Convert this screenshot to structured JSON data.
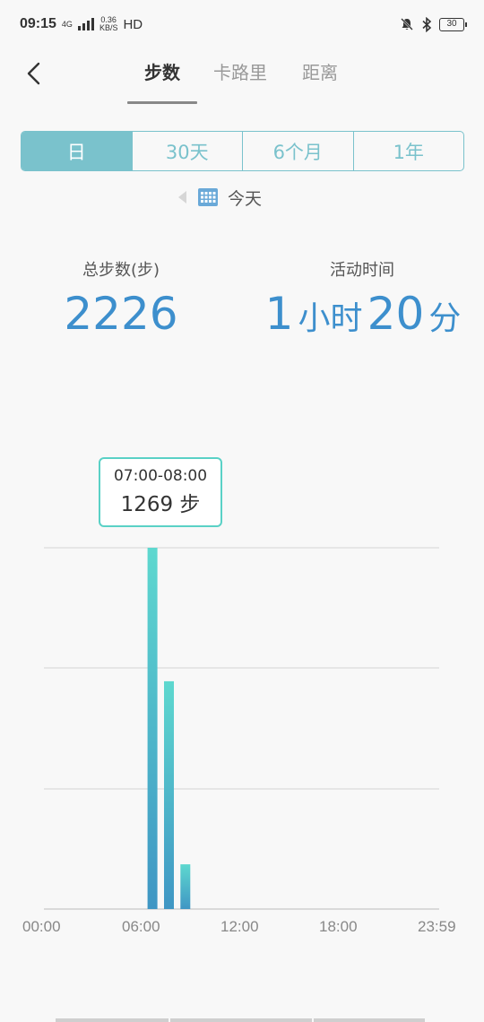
{
  "status_bar": {
    "time": "09:15",
    "network_top": "4G",
    "speed_value": "0.36",
    "speed_unit": "KB/S",
    "hd": "HD",
    "battery": "30"
  },
  "tabs": [
    {
      "label": "步数",
      "active": true
    },
    {
      "label": "卡路里",
      "active": false
    },
    {
      "label": "距离",
      "active": false
    }
  ],
  "periods": [
    {
      "label": "日",
      "active": true
    },
    {
      "label": "30天",
      "active": false
    },
    {
      "label": "6个月",
      "active": false
    },
    {
      "label": "1年",
      "active": false
    }
  ],
  "date_label": "今天",
  "stats": {
    "total_steps_label": "总步数(步)",
    "total_steps_value": "2226",
    "active_time_label": "活动时间",
    "active_hours": "1",
    "hours_unit": "小时",
    "active_minutes": "20",
    "minutes_unit": "分"
  },
  "tooltip": {
    "time_range": "07:00-08:00",
    "value_text": "1269 步"
  },
  "colors": {
    "accent": "#7ac2cc",
    "value_blue": "#3d8fcd",
    "bar_top": "#5ed8cf",
    "bar_bottom": "#3f96c4",
    "tooltip_border": "#5ad1c6"
  },
  "chart_data": {
    "type": "bar",
    "x_unit_hours": [
      7,
      8,
      9
    ],
    "values": [
      1269,
      800,
      157
    ],
    "x_ticks": [
      "00:00",
      "06:00",
      "12:00",
      "18:00",
      "23:59"
    ],
    "ylim": [
      0,
      1269
    ],
    "grid": true
  }
}
